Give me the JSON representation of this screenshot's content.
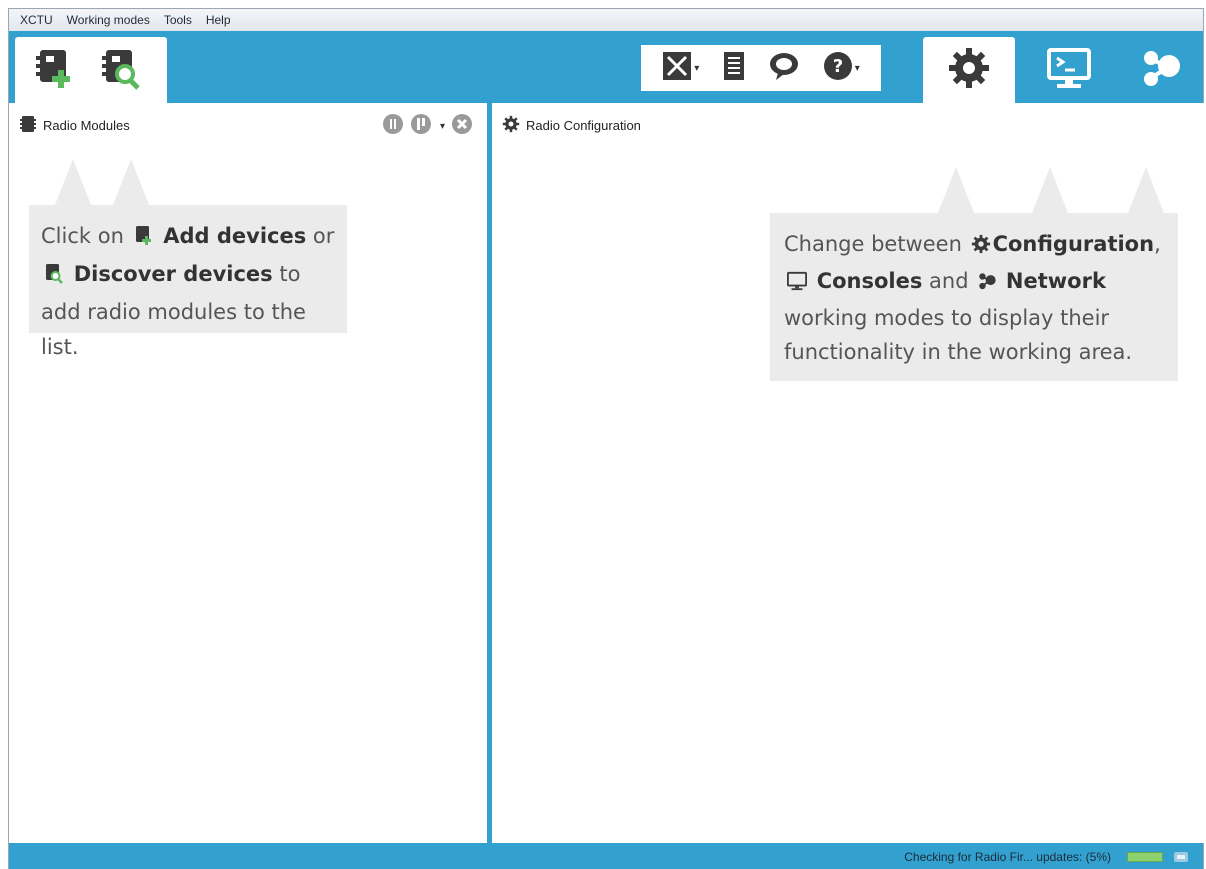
{
  "menu": {
    "items": [
      "XCTU",
      "Working modes",
      "Tools",
      "Help"
    ]
  },
  "toolbar": {
    "add_devices_icon": "add-device-icon",
    "discover_devices_icon": "discover-device-icon",
    "tools_icons": [
      "tools-icon",
      "list-icon",
      "feedback-icon",
      "help-icon"
    ],
    "modes": [
      "gear-icon",
      "console-icon",
      "network-icon"
    ]
  },
  "left_panel": {
    "title": "Radio Modules"
  },
  "right_panel": {
    "title": "Radio Configuration"
  },
  "left_callout": {
    "part1": "Click on",
    "add_label": "Add devices",
    "part2": "or",
    "discover_label": "Discover devices",
    "part3": "to add radio modules to the list."
  },
  "right_callout": {
    "part1": "Change between",
    "config_label": "Configuration",
    "comma": ",",
    "consoles_label": "Consoles",
    "and": "and",
    "network_label": "Network",
    "part2": "working modes to display their functionality in the working area."
  },
  "status": {
    "text": "Checking for Radio Fir... updates: (5%)",
    "progress_percent": 5
  },
  "colors": {
    "accent": "#32a1cf",
    "callout_bg": "#ebebeb",
    "icon_dark": "#3a3a3a",
    "icon_green": "#5cb85c"
  }
}
